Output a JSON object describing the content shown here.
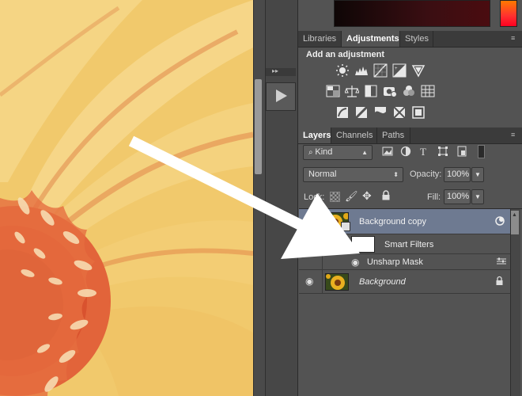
{
  "adjustments_panel": {
    "tabs": [
      "Libraries",
      "Adjustments",
      "Styles"
    ],
    "active_tab": "Adjustments",
    "heading": "Add an adjustment"
  },
  "layers_panel": {
    "tabs": [
      "Layers",
      "Channels",
      "Paths"
    ],
    "active_tab": "Layers",
    "filter_kind": "Kind",
    "blend_mode": "Normal",
    "opacity_label": "Opacity:",
    "opacity_value": "100%",
    "lock_label": "Lock:",
    "fill_label": "Fill:",
    "fill_value": "100%",
    "layers": [
      {
        "name": "Background copy",
        "selected": true
      },
      {
        "name": "Smart Filters"
      },
      {
        "name": "Unsharp Mask"
      },
      {
        "name": "Background",
        "locked": true
      }
    ]
  },
  "colors": {
    "panel_bg": "#535353",
    "selected_layer": "#6e7a91",
    "canvas_petal": "#f3cf7a",
    "arrow": "#ffffff"
  },
  "icons": [
    "brightness-icon",
    "levels-icon",
    "curves-icon",
    "exposure-icon",
    "vibrance-icon",
    "hue-saturation-icon",
    "color-balance-icon",
    "black-white-icon",
    "photo-filter-icon",
    "channel-mixer-icon",
    "color-lookup-icon",
    "invert-icon",
    "posterize-icon",
    "threshold-icon",
    "gradient-map-icon",
    "selective-color-icon"
  ]
}
